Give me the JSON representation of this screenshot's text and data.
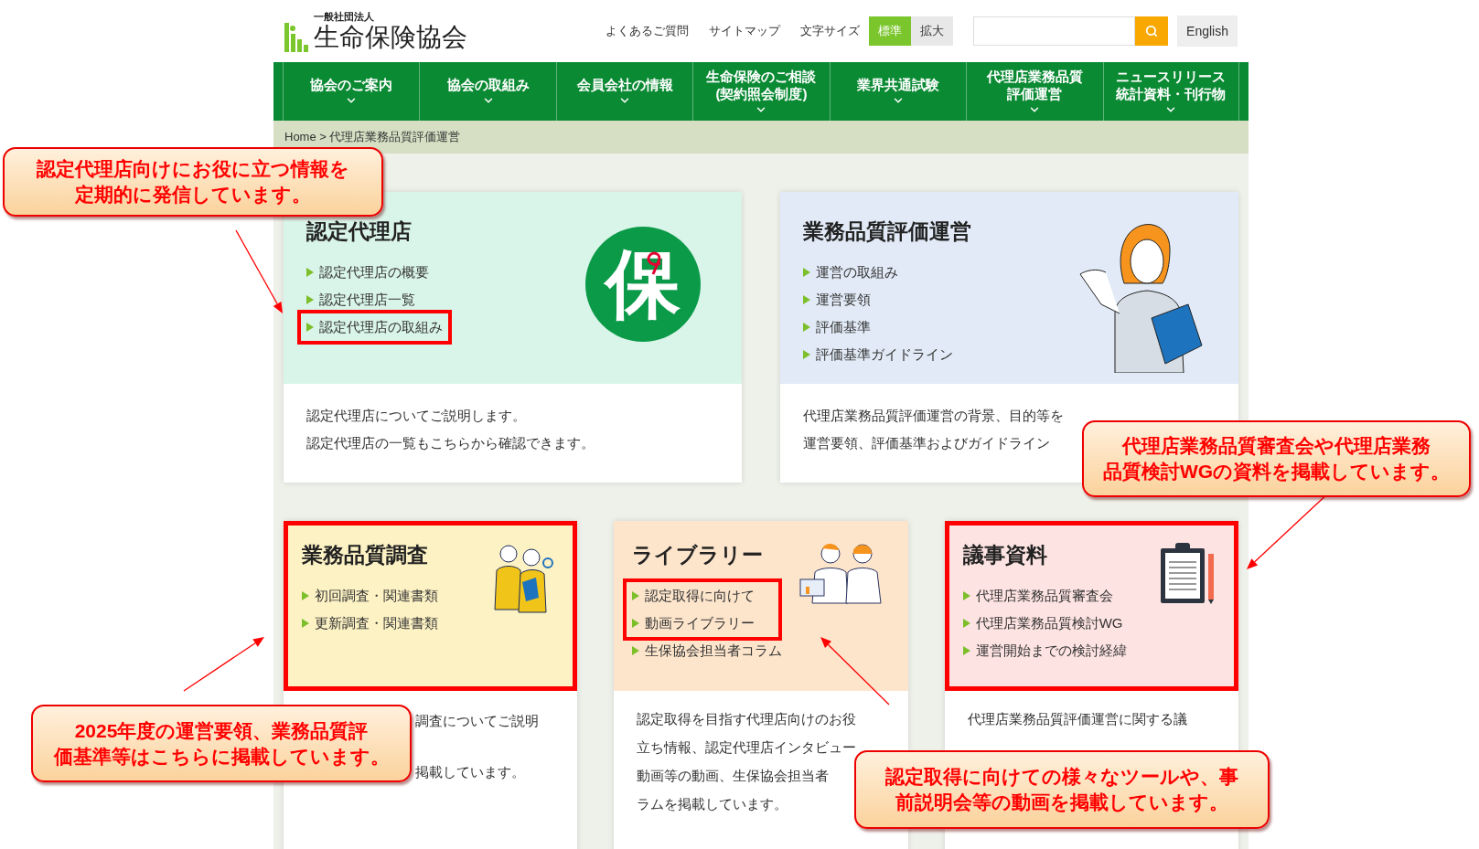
{
  "header": {
    "logo": {
      "small": "一般社団法人",
      "name": "生命保険協会"
    },
    "links": [
      "よくあるご質問",
      "サイトマップ"
    ],
    "font_size": {
      "label": "文字サイズ",
      "options": [
        {
          "label": "標準",
          "selected": true
        },
        {
          "label": "拡大",
          "selected": false
        }
      ]
    },
    "language_button": "English"
  },
  "nav": [
    {
      "lines": [
        "協会のご案内"
      ]
    },
    {
      "lines": [
        "協会の取組み"
      ]
    },
    {
      "lines": [
        "会員会社の情報"
      ]
    },
    {
      "lines": [
        "生命保険のご相談",
        "(契約照会制度)"
      ]
    },
    {
      "lines": [
        "業界共通試験"
      ]
    },
    {
      "lines": [
        "代理店業務品質",
        "評価運営"
      ]
    },
    {
      "lines": [
        "ニュースリリース",
        "統計資料・刊行物"
      ]
    }
  ],
  "breadcrumb": "Home > 代理店業務品質評価運営",
  "cards": [
    {
      "kind": "emblem",
      "emblem": "保",
      "title": "認定代理店",
      "color": "#d9f4e9",
      "highlighted": false,
      "links": [
        {
          "label": "認定代理店の概要",
          "highlighted": false
        },
        {
          "label": "認定代理店一覧",
          "highlighted": false
        },
        {
          "label": "認定代理店の取組み",
          "highlighted": true
        }
      ],
      "description": [
        "認定代理店についてご説明します。",
        "認定代理店の一覧もこちらから確認できます。"
      ]
    },
    {
      "kind": "woman",
      "title": "業務品質評価運営",
      "color": "#e1eaf6",
      "highlighted": false,
      "links": [
        {
          "label": "運営の取組み",
          "highlighted": false
        },
        {
          "label": "運営要領",
          "highlighted": false
        },
        {
          "label": "評価基準",
          "highlighted": false
        },
        {
          "label": "評価基準ガイドライン",
          "highlighted": false
        }
      ],
      "description": [
        "代理店業務品質評価運営の背景、目的等を",
        "運営要領、評価基準およびガイドライン"
      ]
    },
    {
      "kind": "researchers",
      "title": "業務品質調査",
      "color": "#fdf2c4",
      "highlighted": true,
      "links": [
        {
          "label": "初回調査・関連書類",
          "highlighted": false
        },
        {
          "label": "更新調査・関連書類",
          "highlighted": false
        }
      ],
      "description": [
        "調査についてご説明",
        "掲載しています。"
      ]
    },
    {
      "kind": "consultants",
      "title": "ライブラリー",
      "color": "#fde5cc",
      "highlighted": false,
      "links": [
        {
          "label": "認定取得に向けて",
          "highlighted": true
        },
        {
          "label": "動画ライブラリー",
          "highlighted": true
        },
        {
          "label": "生保協会担当者コラム",
          "highlighted": false
        }
      ],
      "description": [
        "認定取得を目指す代理店向けのお役",
        "立ち情報、認定代理店インタビュー",
        "動画等の動画、生保協会担当者",
        "ラムを掲載しています。"
      ]
    },
    {
      "kind": "clipboard",
      "title": "議事資料",
      "color": "#fde3e1",
      "highlighted": true,
      "links": [
        {
          "label": "代理店業務品質審査会",
          "highlighted": false
        },
        {
          "label": "代理店業務品質検討WG",
          "highlighted": false
        },
        {
          "label": "運営開始までの検討経緯",
          "highlighted": false
        }
      ],
      "description": [
        "代理店業務品質評価運営に関する議"
      ]
    }
  ],
  "callouts": [
    {
      "lines": [
        "認定代理店向けにお役に立つ情報を",
        "定期的に発信しています。"
      ]
    },
    {
      "lines": [
        "代理店業務品質審査会や代理店業務",
        "品質検討WGの資料を掲載しています。"
      ]
    },
    {
      "lines": [
        "2025年度の運営要領、業務品質評",
        "価基準等はこちらに掲載しています。"
      ]
    },
    {
      "lines": [
        "認定取得に向けての様々なツールや、事",
        "前説明会等の動画を掲載しています。"
      ]
    }
  ]
}
